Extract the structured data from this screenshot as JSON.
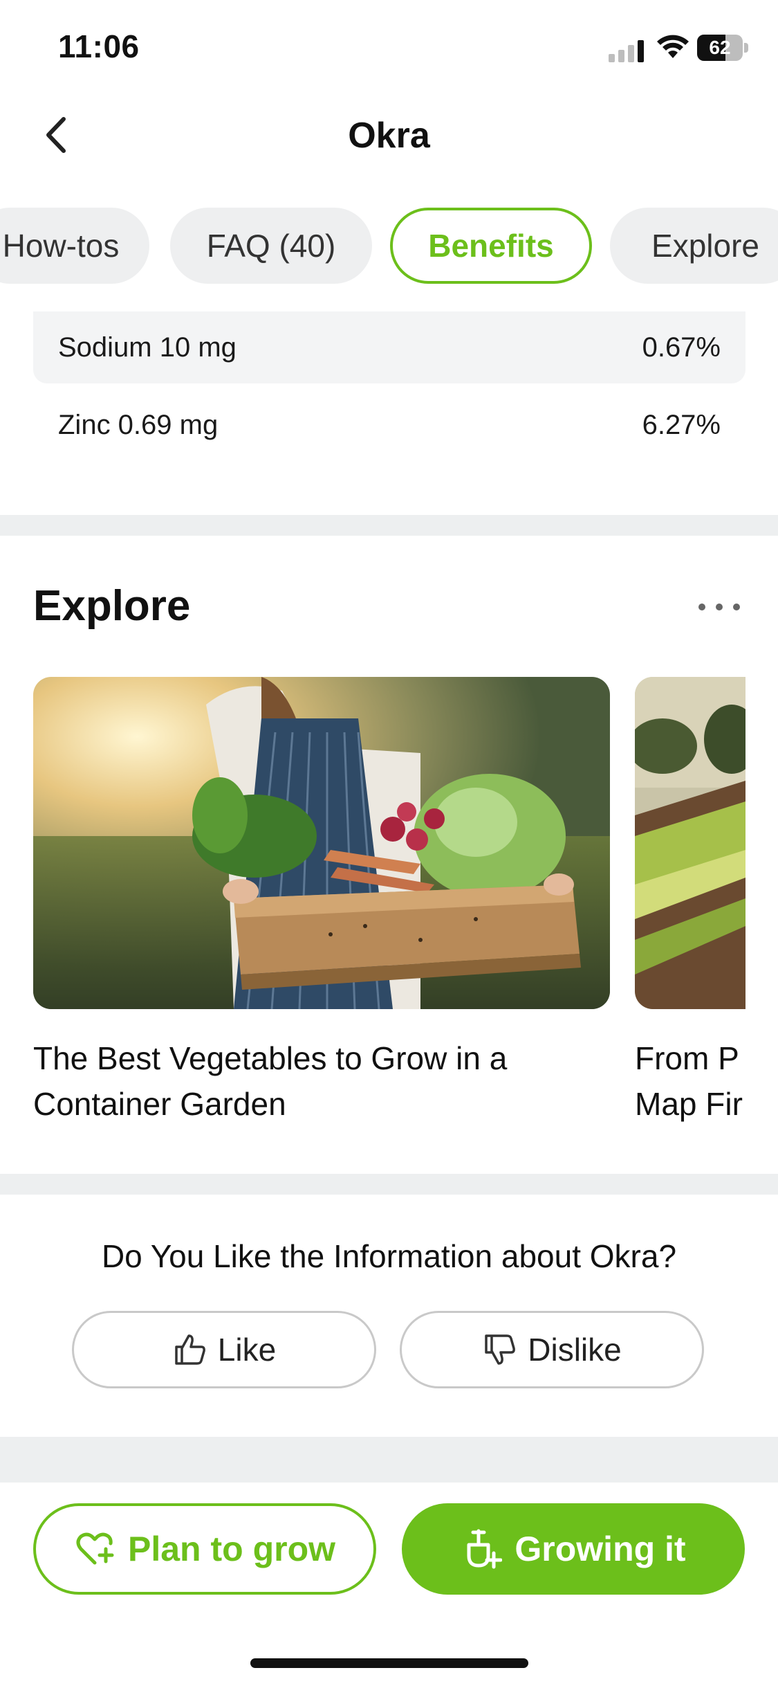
{
  "status_bar": {
    "time": "11:06",
    "battery": "62",
    "battery_level": 0.62
  },
  "nav": {
    "title": "Okra"
  },
  "tabs": [
    {
      "label": "How-tos",
      "active": false
    },
    {
      "label": "FAQ (40)",
      "active": false
    },
    {
      "label": "Benefits",
      "active": true
    },
    {
      "label": "Explore",
      "active": false
    }
  ],
  "nutrition": [
    {
      "name": "Sodium 10 mg",
      "value": "0.67%"
    },
    {
      "name": "Zinc 0.69 mg",
      "value": "6.27%"
    }
  ],
  "explore": {
    "title": "Explore",
    "cards": [
      {
        "title": "The Best Vegetables to Grow in a Container Garden"
      },
      {
        "title": "From P\nMap Fir"
      }
    ]
  },
  "feedback": {
    "question": "Do You Like the Information about Okra?",
    "like_label": "Like",
    "dislike_label": "Dislike"
  },
  "actions": {
    "plan_label": "Plan to grow",
    "growing_label": "Growing it"
  },
  "colors": {
    "accent": "#6cbf1b",
    "divider": "#edeff0",
    "row_shade": "#f3f4f5"
  }
}
